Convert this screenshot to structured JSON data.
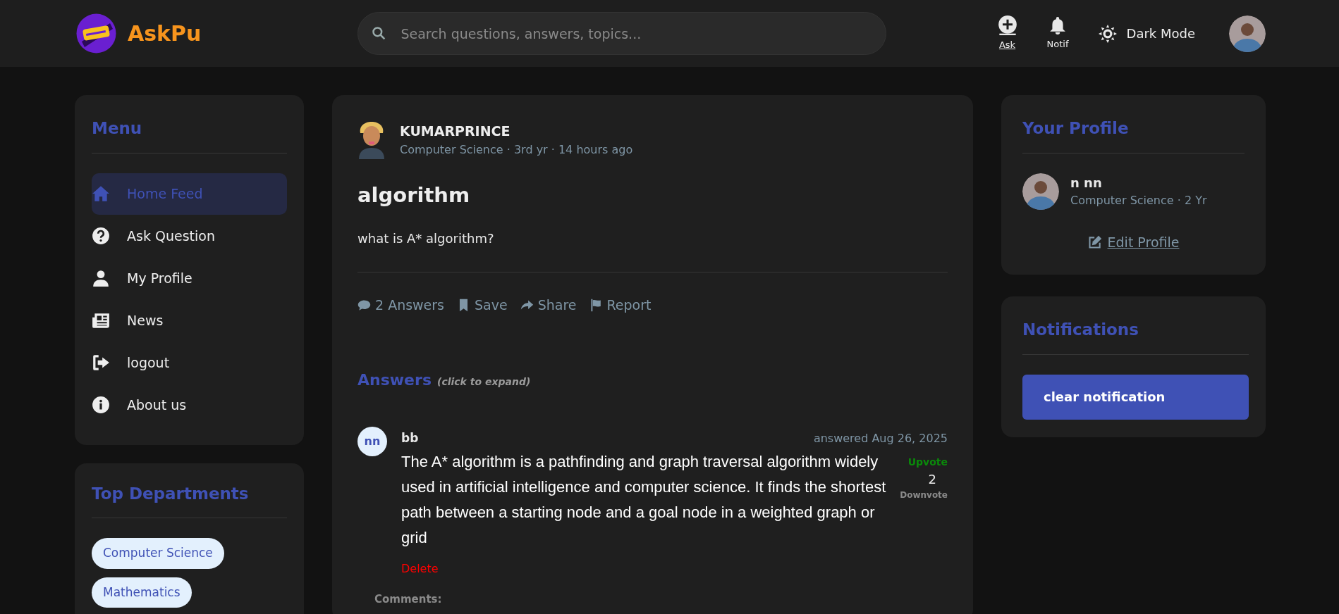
{
  "header": {
    "brand": "AskPu",
    "search": {
      "placeholder": "Search questions, answers, topics..."
    },
    "actions": [
      {
        "label": "Ask",
        "kind": "ask"
      },
      {
        "label": "Notif",
        "kind": "notif"
      }
    ],
    "theme_toggle": "Dark Mode"
  },
  "menu": {
    "title": "Menu",
    "items": [
      {
        "label": "Home Feed",
        "selected": true
      },
      {
        "label": "Ask Question",
        "selected": false
      },
      {
        "label": "My Profile",
        "selected": false
      },
      {
        "label": "News",
        "selected": false
      },
      {
        "label": "logout",
        "selected": false
      },
      {
        "label": "About us",
        "selected": false
      }
    ]
  },
  "departments": {
    "title": "Top Departments",
    "items": [
      "Computer Science",
      "Mathematics"
    ]
  },
  "question": {
    "author": "KUMARPRINCE",
    "meta": "Computer Science · 3rd yr · 14 hours ago",
    "title": "algorithm",
    "body": "what is A* algorithm?",
    "actions": [
      {
        "label": "2 Answers",
        "kind": "answers"
      },
      {
        "label": "Save",
        "kind": "save"
      },
      {
        "label": "Share",
        "kind": "share"
      },
      {
        "label": "Report",
        "kind": "report"
      }
    ],
    "answers_heading": "Answers",
    "answers_hint": "(click to expand)",
    "answers": [
      {
        "initials": "nn",
        "author": "bb",
        "date": "answered Aug 26, 2025",
        "text": "The A* algorithm is a pathfinding and graph traversal algorithm widely used in artificial intelligence and computer science. It finds the shortest path between a starting node and a goal node in a weighted graph or grid",
        "upvote": "Upvote",
        "score": "2",
        "downvote": "Downvote",
        "upvoted": true,
        "delete": "Delete"
      }
    ],
    "comments_label": "Comments:"
  },
  "profile": {
    "title": "Your Profile",
    "name": "n nn",
    "meta": "Computer Science · 2 Yr",
    "edit": "Edit Profile"
  },
  "notifications": {
    "title": "Notifications",
    "button": "clear notification"
  }
}
